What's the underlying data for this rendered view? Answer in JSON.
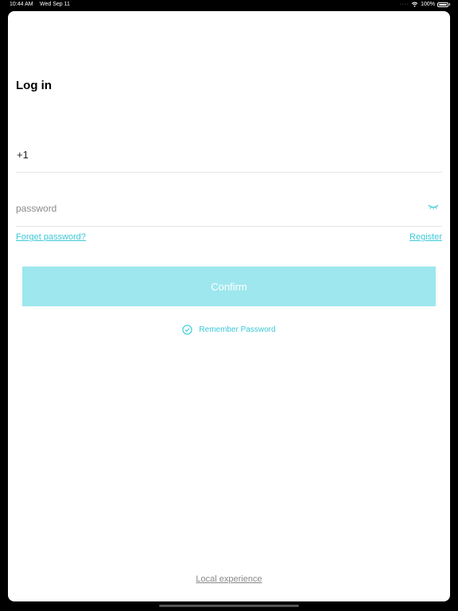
{
  "status_bar": {
    "time": "10:44 AM",
    "date": "Wed Sep 11",
    "battery": "100%",
    "icons": [
      "signal-dots-icon",
      "wifi-icon",
      "battery-icon"
    ]
  },
  "login": {
    "title": "Log in",
    "phone_prefix": "+1",
    "password_placeholder": "password",
    "forget_password": "Forget password?",
    "register": "Register",
    "confirm": "Confirm",
    "remember_password": "Remember Password",
    "local_experience": "Local experience"
  },
  "colors": {
    "accent": "#3cc9d8",
    "confirm_bg": "#9ee7ee",
    "divider": "#e6e6e6"
  }
}
